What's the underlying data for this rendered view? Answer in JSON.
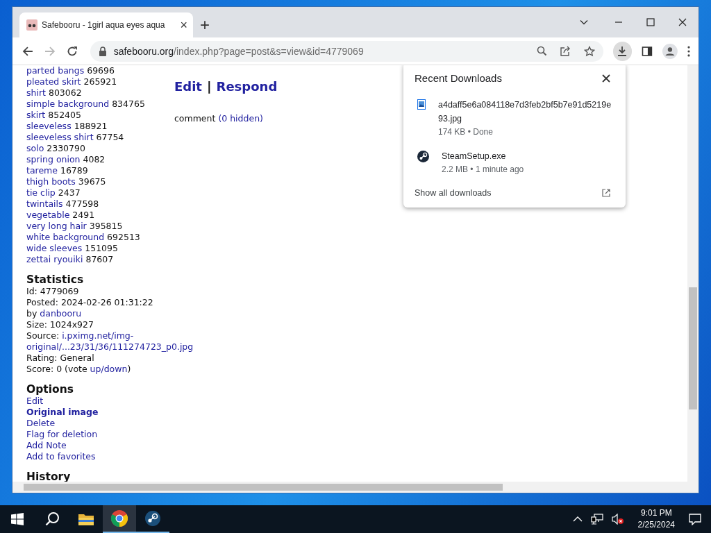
{
  "browser": {
    "tab": {
      "title": "Safebooru - 1girl aqua eyes aqua",
      "close": "×"
    },
    "new_tab": "+",
    "nav_buttons": [
      {
        "kind": "back",
        "disabled": false
      },
      {
        "kind": "forward",
        "disabled": true
      },
      {
        "kind": "reload",
        "disabled": false
      }
    ],
    "address": {
      "host": "safebooru.org",
      "path": "/index.php?page=post&s=view&id=4779069"
    },
    "downloads_button": {
      "selected": true
    }
  },
  "page": {
    "tags": [
      {
        "name": "parted bangs",
        "count": "69696"
      },
      {
        "name": "pleated skirt",
        "count": "265921"
      },
      {
        "name": "shirt",
        "count": "803062"
      },
      {
        "name": "simple background",
        "count": "834765"
      },
      {
        "name": "skirt",
        "count": "852405"
      },
      {
        "name": "sleeveless",
        "count": "188921"
      },
      {
        "name": "sleeveless shirt",
        "count": "67754"
      },
      {
        "name": "solo",
        "count": "2330790"
      },
      {
        "name": "spring onion",
        "count": "4082"
      },
      {
        "name": "tareme",
        "count": "16789"
      },
      {
        "name": "thigh boots",
        "count": "39675"
      },
      {
        "name": "tie clip",
        "count": "2437"
      },
      {
        "name": "twintails",
        "count": "477598"
      },
      {
        "name": "vegetable",
        "count": "2491"
      },
      {
        "name": "very long hair",
        "count": "395815"
      },
      {
        "name": "white background",
        "count": "692513"
      },
      {
        "name": "wide sleeves",
        "count": "151095"
      },
      {
        "name": "zettai ryouiki",
        "count": "87607"
      }
    ],
    "statistics": {
      "heading": "Statistics",
      "lines": [
        {
          "text": "Id: 4779069"
        },
        {
          "text": "Posted: 2024-02-26 01:31:22"
        },
        {
          "text": "by ",
          "link": "danbooru"
        },
        {
          "text": "Size: 1024x927"
        },
        {
          "text": "Source: ",
          "link": "i.pximg.net/img-original/...23/31/36/111274723_p0.jpg",
          "kind": "wrap"
        },
        {
          "text": "Rating: General"
        },
        {
          "text": "Score: 0 (vote ",
          "link": "up/down",
          "after": ")"
        }
      ]
    },
    "options": {
      "heading": "Options",
      "links": [
        {
          "label": "Edit",
          "bold": false
        },
        {
          "label": "Original image",
          "bold": true
        },
        {
          "label": "Delete",
          "bold": false
        },
        {
          "label": "Flag for deletion",
          "bold": false
        },
        {
          "label": "Add Note",
          "bold": false
        },
        {
          "label": "Add to favorites",
          "bold": false
        }
      ]
    },
    "history": {
      "heading": "History"
    },
    "post_actions": {
      "edit": "Edit",
      "separator": "|",
      "respond": "Respond"
    },
    "comment": {
      "label": "comment",
      "hidden_link": "(0 hidden)"
    }
  },
  "downloads_popup": {
    "title": "Recent Downloads",
    "items": [
      {
        "kind": "image",
        "name": "a4daff5e6a084118e7d3feb2bf5b7e91d5219e93.jpg",
        "status": "174 KB • Done"
      },
      {
        "kind": "steam",
        "name": "SteamSetup.exe",
        "status": "2.2 MB • 1 minute ago"
      }
    ],
    "show_all": "Show all downloads"
  },
  "taskbar": {
    "apps": [
      {
        "kind": "search",
        "running": false,
        "selected": false
      },
      {
        "kind": "explorer",
        "running": false,
        "selected": false
      },
      {
        "kind": "chrome",
        "running": true,
        "selected": true
      },
      {
        "kind": "steam",
        "running": true,
        "selected": false
      }
    ],
    "time": "9:01 PM",
    "date": "2/25/2024"
  }
}
